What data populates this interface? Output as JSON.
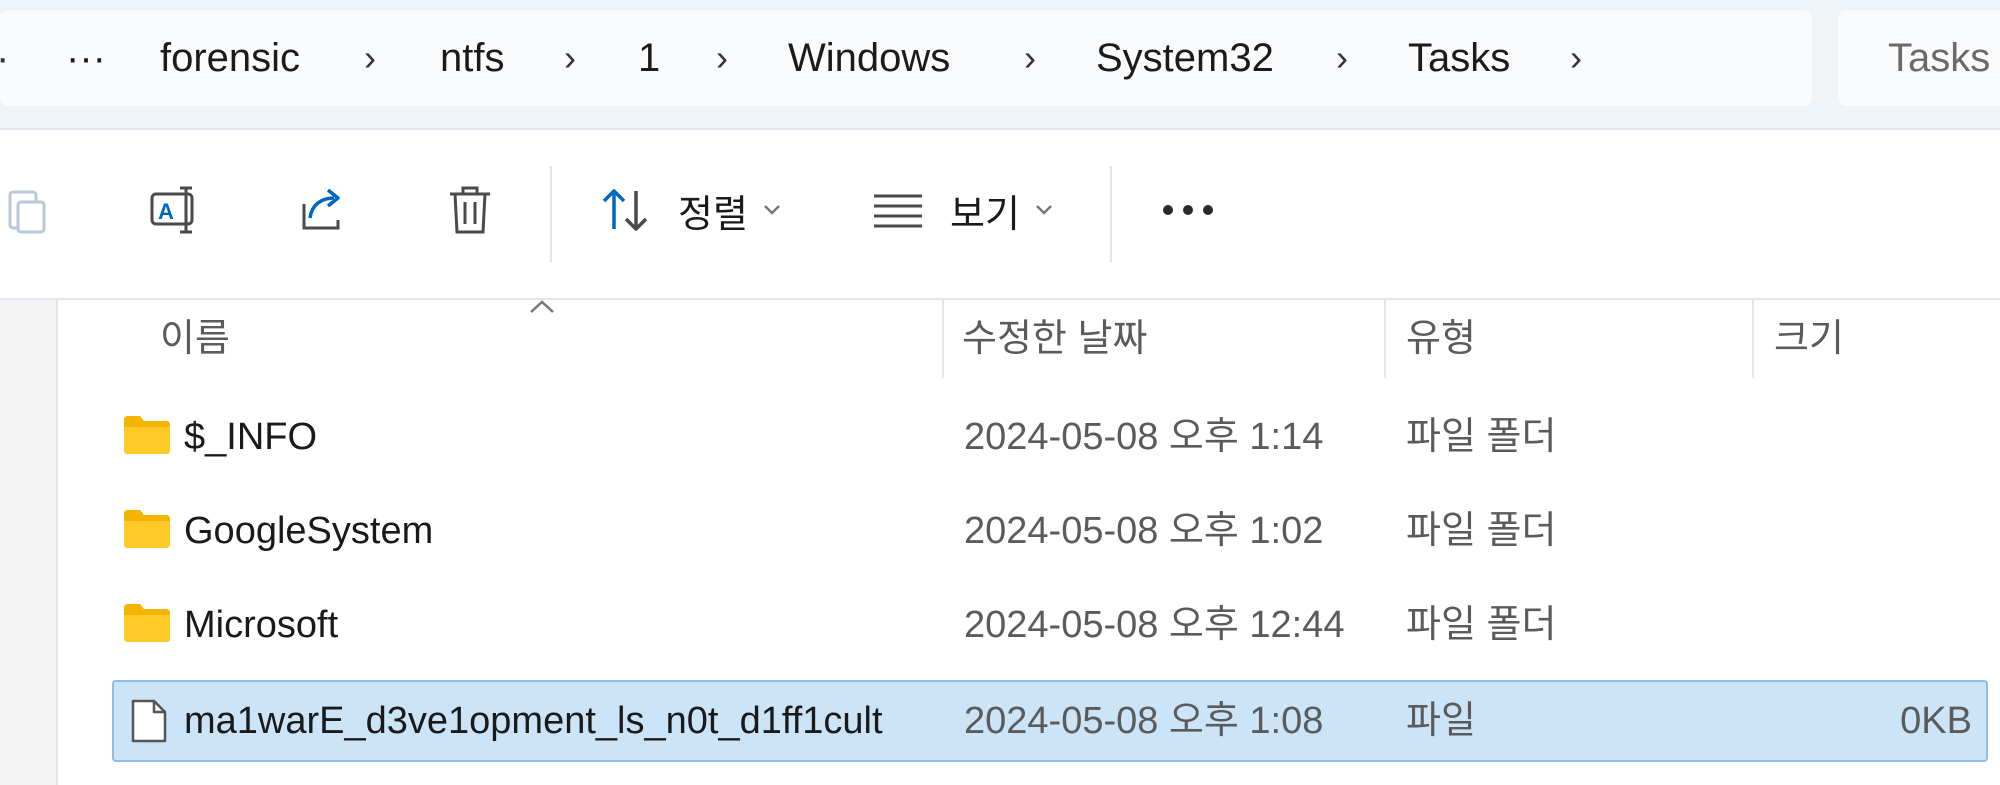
{
  "address_bar": {
    "overflow_label": "···",
    "crumbs": [
      "forensic",
      "ntfs",
      "1",
      "Windows",
      "System32",
      "Tasks"
    ],
    "separator": "›",
    "search_placeholder": "Tasks"
  },
  "command_bar": {
    "sort_label": "정렬",
    "view_label": "보기",
    "more_label": "···",
    "icons": [
      "paste-icon",
      "rename-icon",
      "share-icon",
      "delete-icon",
      "sort-icon",
      "view-icon",
      "more-icon"
    ]
  },
  "file_list": {
    "columns": [
      "이름",
      "수정한 날짜",
      "유형",
      "크기"
    ],
    "sort_column": "이름",
    "rows": [
      {
        "name": "$_INFO",
        "modified": "2024-05-08 오후 1:14",
        "type": "파일 폴더",
        "size": "",
        "icon": "folder-icon",
        "selected": false
      },
      {
        "name": "GoogleSystem",
        "modified": "2024-05-08 오후 1:02",
        "type": "파일 폴더",
        "size": "",
        "icon": "folder-icon",
        "selected": false
      },
      {
        "name": "Microsoft",
        "modified": "2024-05-08 오후 12:44",
        "type": "파일 폴더",
        "size": "",
        "icon": "folder-icon",
        "selected": false
      },
      {
        "name": "ma1warE_d3ve1opment_ls_n0t_d1ff1cult",
        "modified": "2024-05-08 오후 1:08",
        "type": "파일",
        "size": "0KB",
        "icon": "file-icon",
        "selected": true
      }
    ]
  },
  "colors": {
    "accent": "#0067c0",
    "selection_bg": "#cce4f7",
    "selection_border": "#8fbfe6",
    "folder": "#ffca28"
  }
}
